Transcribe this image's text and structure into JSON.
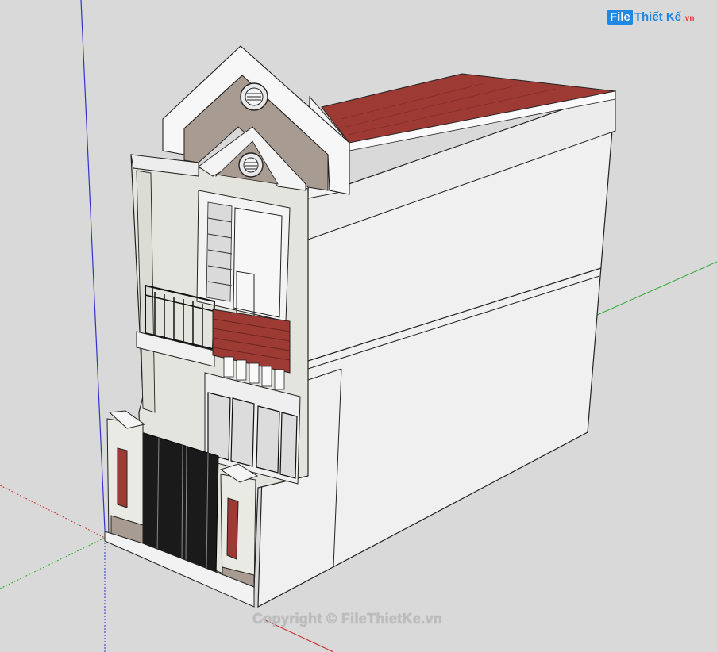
{
  "watermark": {
    "logo_box": "File",
    "logo_text": "Thiết Kế",
    "logo_suffix": ".vn",
    "copyright": "Copyright © FileThietKe.vn"
  },
  "colors": {
    "background": "#d9d9d9",
    "roof": "#9c3a33",
    "wall": "#f2f2f2",
    "axis_blue": "#3333cc",
    "axis_green": "#33aa33",
    "axis_red": "#cc3333",
    "logo_blue": "#1e88e5",
    "logo_red": "#e53935"
  },
  "icons": [
    "house-3d-model",
    "axis-lines",
    "logo-icon"
  ]
}
